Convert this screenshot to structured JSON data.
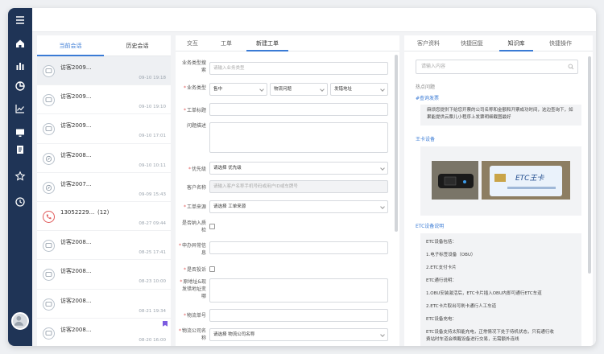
{
  "sessions": {
    "tabs": [
      "当前会话",
      "历史会话"
    ],
    "items": [
      {
        "name": "访客2009...",
        "time": "09-10 19:18",
        "type": "chat"
      },
      {
        "name": "访客2009...",
        "time": "09-10 19:10",
        "type": "chat"
      },
      {
        "name": "访客2009...",
        "time": "09-10 17:01",
        "type": "chat"
      },
      {
        "name": "访客2008...",
        "time": "09-10 10:11",
        "type": "chat"
      },
      {
        "name": "访客2007...",
        "time": "09-09 15:43",
        "type": "chat"
      },
      {
        "name": "13052229...",
        "count": "(12)",
        "time": "08-27 09:44",
        "type": "phone"
      },
      {
        "name": "访客2008...",
        "time": "08-25 17:41",
        "type": "chat"
      },
      {
        "name": "访客2008...",
        "time": "08-23 10:00",
        "type": "chat"
      },
      {
        "name": "访客2008...",
        "time": "08-21 19:34",
        "type": "chat"
      },
      {
        "name": "访客2008...",
        "time": "08-20 16:00",
        "type": "chat"
      }
    ]
  },
  "form": {
    "tabs": [
      "交互",
      "工单",
      "新建工单"
    ],
    "fields": {
      "biz_type_search": {
        "label": "业务类型搜索",
        "placeholder": "请输入业务类型"
      },
      "biz_type": {
        "label": "业务类型",
        "values": [
          "售中",
          "物流问题",
          "发错地址"
        ]
      },
      "ticket_title": {
        "label": "工单标题"
      },
      "description": {
        "label": "问题描述"
      },
      "priority": {
        "label": "优先级",
        "value": "请选择 优先级"
      },
      "customer": {
        "label": "客户名称",
        "placeholder": "请输入客户名称手机号码或用户ID或车牌号"
      },
      "source": {
        "label": "工单来源",
        "value": "请选择 工单来源"
      },
      "quality": {
        "label": "是否纳入质检"
      },
      "abnormal": {
        "label": "申办异常信息"
      },
      "complaint": {
        "label": "是否投诉"
      },
      "address": {
        "label": "原地址&现发错地址变哪"
      },
      "logistics_no": {
        "label": "物流单号"
      },
      "logistics_company": {
        "label": "物流公司名称",
        "value": "请选择 物流公司名称"
      }
    }
  },
  "knowledge": {
    "tabs": [
      "客户资料",
      "快捷回复",
      "知识库",
      "快捷操作"
    ],
    "search_placeholder": "请输入内容",
    "hot_label": "热点问题",
    "q1": "#查询发票",
    "a1": "麻烦您提供下给您开票的公司名称和金额和开票成功时间，这边查询下，如果能提供云票儿小程序上发票明细截图最好",
    "q2": "王卡设备",
    "q3": "ETC设备说明",
    "etc_lines": [
      "ETC设备包括：",
      "1.电子标签设备（OBU）",
      "2.ETC支付卡片",
      "ETC通行说明：",
      "1.OBU安装激活后，ETC卡片插入OBU内即可通行ETC车道",
      "2.ETC卡片取出可刷卡通行人工车道",
      "ETC设备充电：",
      "ETC设备支持太阳能充电，正常情况下处于待机状态，只有通行收",
      "费站时车道会唤醒设备进行交易，无需额外连线"
    ],
    "card_logo": "ETC王卡"
  }
}
